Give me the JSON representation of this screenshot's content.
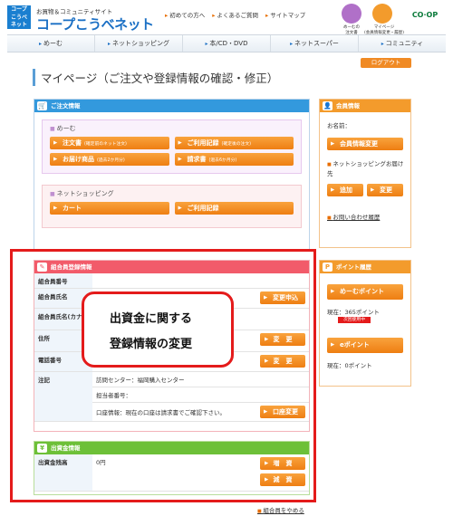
{
  "header": {
    "logo_lines": [
      "コープ",
      "こうべ",
      "ネット"
    ],
    "tagline": "お買物＆コミュニティサイト",
    "brand": "コープこうべネット",
    "top_links": [
      "初めての方へ",
      "よくあるご質問",
      "サイトマップ"
    ],
    "icon_labels": [
      "めーむの\n注文書",
      "マイページ\n(会員情報変更・履歴)"
    ],
    "coop_logo": "CO·OP"
  },
  "nav": [
    "めーむ",
    "ネットショッピング",
    "本/CD・DVD",
    "ネットスーパー",
    "コミュニティ"
  ],
  "page": {
    "title": "マイページ（ご注文や登録情報の確認・修正）",
    "logout": "ログアウト"
  },
  "order_panel": {
    "heading": "ご注文情報",
    "meem": {
      "title": "めーむ",
      "buttons": [
        {
          "label": "注文書",
          "note": "(確定前のネット注文)"
        },
        {
          "label": "ご利用記録",
          "note": "(確定後の注文)"
        },
        {
          "label": "お届け商品",
          "note": "(過去2か月分)"
        },
        {
          "label": "請求書",
          "note": "(過去6か月分)"
        }
      ]
    },
    "shopping": {
      "title": "ネットショッピング",
      "buttons": [
        {
          "label": "カート"
        },
        {
          "label": "ご利用記録"
        }
      ]
    }
  },
  "member_panel": {
    "heading": "会員情報",
    "name_label": "お名前：",
    "change_button": "会員情報変更",
    "delivery_title": "ネットショッピングお届け先",
    "add_button": "追加",
    "edit_button": "変更",
    "contact_link": "お問い合わせ履歴"
  },
  "union_panel": {
    "heading": "組合員登録情報",
    "rows": [
      {
        "label": "組合員番号",
        "value": "",
        "button": ""
      },
      {
        "label": "組合員氏名",
        "value": "",
        "button": "変更申込"
      },
      {
        "label": "組合員氏名(カナ)",
        "value": "",
        "button": ""
      },
      {
        "label": "住所",
        "value": "",
        "button": "変　更"
      },
      {
        "label": "電話番号",
        "value": "",
        "button": "変　更"
      }
    ],
    "note_label": "注記",
    "note_lines": [
      "訪問センター：福岡購入センター",
      "担当者番号：",
      "口座情報：現在の口座は請求書でご確認下さい。"
    ],
    "account_button": "口座変更"
  },
  "callout": {
    "line1": "出資金に関する",
    "line2": "登録情報の変更"
  },
  "capital_panel": {
    "heading": "出資金情報",
    "label": "出資金残高",
    "value": "0円",
    "increase_button": "増　資",
    "decrease_button": "減　資"
  },
  "point_panel": {
    "heading": "ポイント履歴",
    "meem_point_button": "めーむポイント",
    "meem_current": "現在：365ポイント",
    "meem_badge": "次回使用中",
    "e_point_button": "eポイント",
    "e_current": "現在：0ポイント"
  },
  "footer_link": "組合員をやめる"
}
